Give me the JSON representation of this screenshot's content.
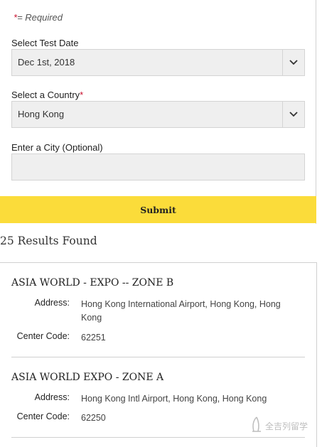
{
  "form": {
    "required_star": "*",
    "required_note": "= Required",
    "test_date_label": "Select Test Date",
    "test_date_value": "Dec 1st, 2018",
    "country_label": "Select a Country",
    "country_star": "*",
    "country_value": "Hong Kong",
    "city_label": "Enter a City (Optional)",
    "city_value": "",
    "submit_label": "Submit"
  },
  "results": {
    "count_text": "25 Results Found",
    "address_label": "Address:",
    "code_label": "Center Code:",
    "items": [
      {
        "title": "ASIA WORLD - EXPO -- ZONE B",
        "address": "Hong Kong International Airport, Hong Kong, Hong Kong",
        "center_code": "62251"
      },
      {
        "title": "ASIA WORLD EXPO - ZONE A",
        "address": "Hong Kong Intl Airport, Hong Kong, Hong Kong",
        "center_code": "62250"
      }
    ]
  },
  "watermark": {
    "text": "全吉列留学"
  },
  "colors": {
    "accent": "#fbdc3a",
    "required": "#c8102e",
    "field_bg": "#efefef"
  }
}
